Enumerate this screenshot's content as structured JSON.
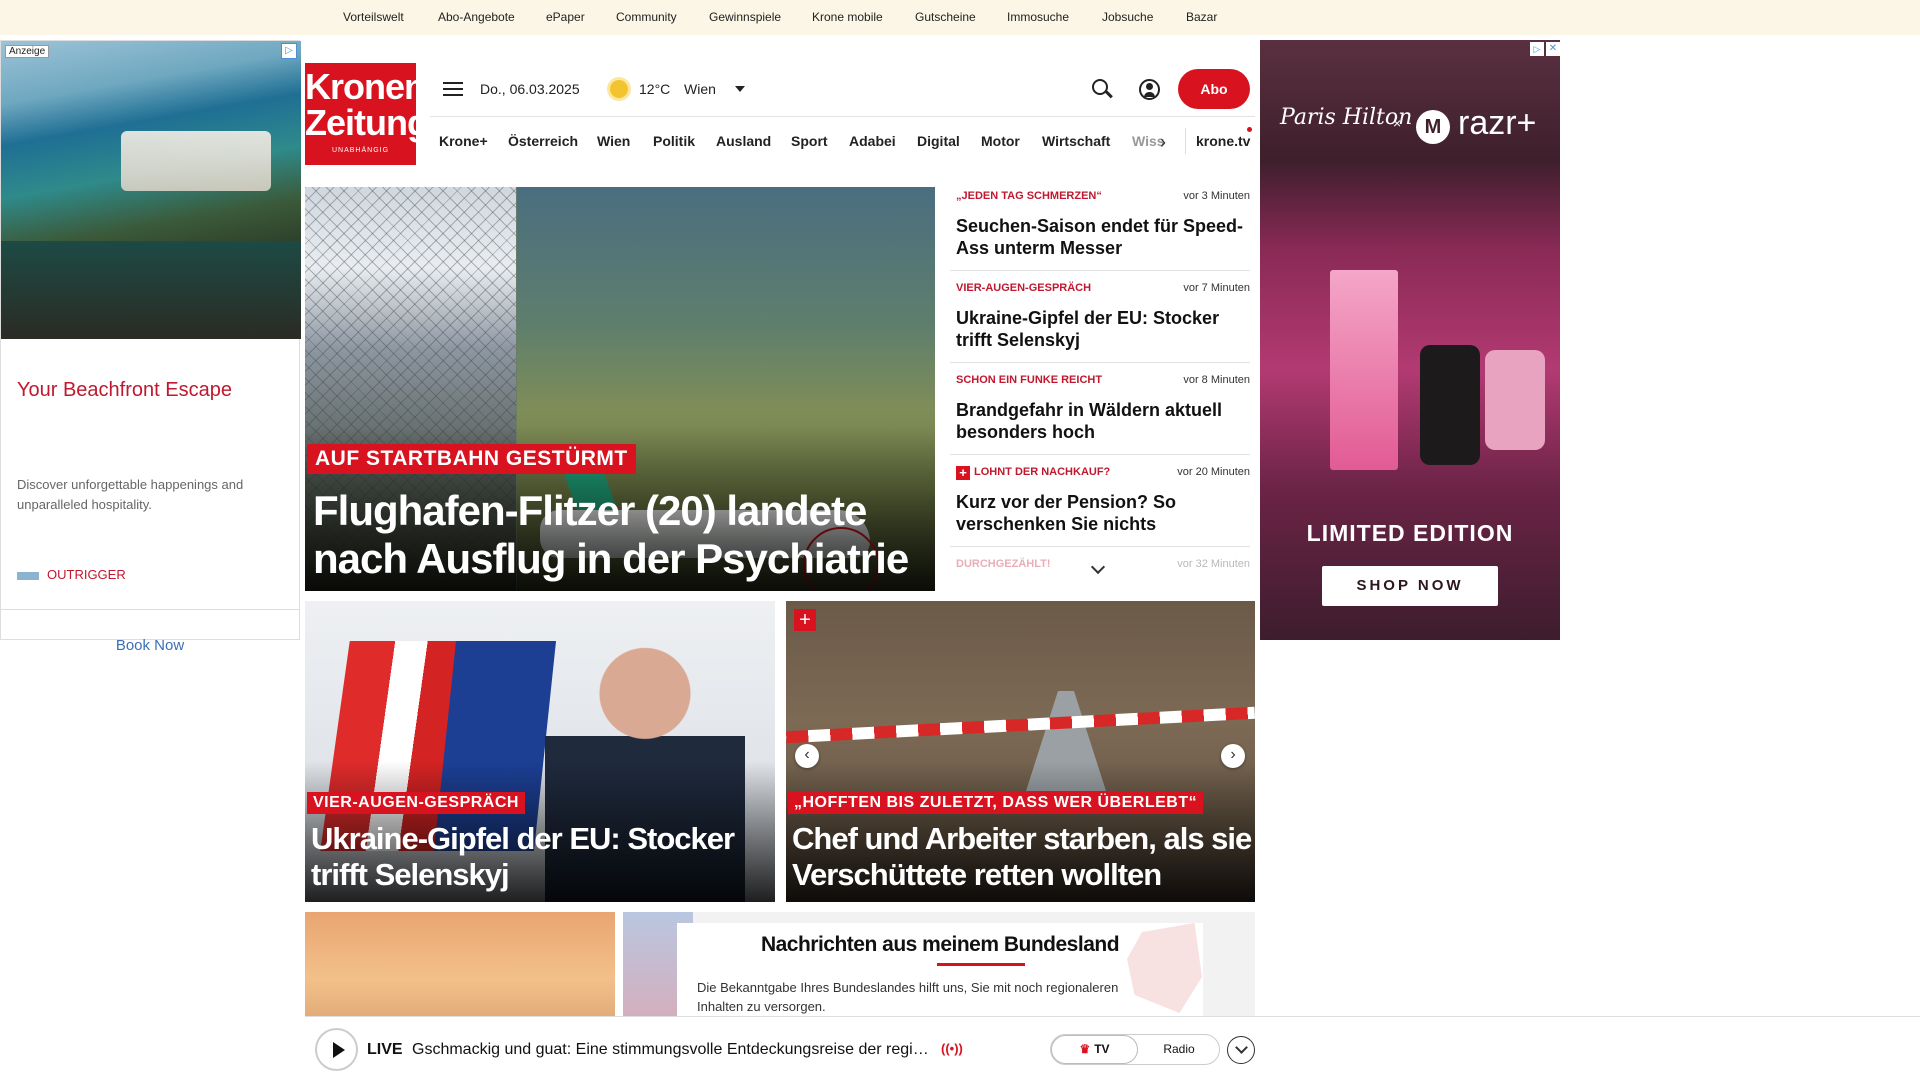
{
  "topbar": {
    "links": [
      "Vorteilswelt",
      "Abo-Angebote",
      "ePaper",
      "Community",
      "Gewinnspiele",
      "Krone mobile",
      "Gutscheine",
      "Immosuche",
      "Jobsuche",
      "Bazar"
    ]
  },
  "ad_left": {
    "tag": "Anzeige",
    "headline": "Your Beachfront Escape",
    "text": "Discover unforgettable happenings and unparalleled hospitality.",
    "brand": "OUTRIGGER",
    "cta": "Book Now"
  },
  "ad_right": {
    "paris_hilton": "Paris Hilton",
    "x": "×",
    "razr": "razr+",
    "limited": "LIMITED EDITION",
    "cta": "SHOP NOW"
  },
  "header": {
    "logo_line1": "Kronen",
    "logo_line2": "Zeitung",
    "logo_line3": "UNABHÄNGIG",
    "date": "Do., 06.03.2025",
    "temperature": "12°C",
    "city": "Wien",
    "abo_label": "Abo"
  },
  "nav": {
    "items": [
      "Krone+",
      "Österreich",
      "Wien",
      "Politik",
      "Ausland",
      "Sport",
      "Adabei",
      "Digital",
      "Motor",
      "Wirtschaft",
      "Wiss"
    ],
    "krone_tv": "krone.tv"
  },
  "hero": {
    "kicker": "AUF STARTBAHN GESTÜRMT",
    "headline": "Flughafen-Flitzer (20) landete nach Ausflug in der Psychiatrie"
  },
  "ticker": [
    {
      "kicker": "„JEDEN TAG SCHMERZEN“",
      "time": "vor 3 Minuten",
      "headline": "Seuchen-Saison endet für Speed-Ass unterm Messer",
      "plus": false
    },
    {
      "kicker": "VIER-AUGEN-GESPRÄCH",
      "time": "vor 7 Minuten",
      "headline": "Ukraine-Gipfel der EU: Stocker trifft Selenskyj",
      "plus": false
    },
    {
      "kicker": "SCHON EIN FUNKE REICHT",
      "time": "vor 8 Minuten",
      "headline": "Brandgefahr in Wäldern aktuell besonders hoch",
      "plus": false
    },
    {
      "kicker": "LOHNT DER NACHKAUF?",
      "time": "vor 20 Minuten",
      "headline": "Kurz vor der Pension? So verschenken Sie nichts",
      "plus": true
    },
    {
      "kicker": "DURCHGEZÄHLT!",
      "time": "vor 32 Minuten",
      "headline": "",
      "plus": false
    }
  ],
  "cards": [
    {
      "kicker": "VIER-AUGEN-GESPRÄCH",
      "headline": "Ukraine-Gipfel der EU: Stocker trifft Selenskyj"
    },
    {
      "kicker": "„HOFFTEN BIS ZULETZT, DASS WER ÜBERLEBT“",
      "headline": "Chef und Arbeiter starben, als sie Verschüttete retten wollten"
    }
  ],
  "bundesland": {
    "title": "Nachrichten aus meinem Bundesland",
    "text": "Die Bekanntgabe Ihres Bundeslandes hilft uns, Sie mit noch regionaleren Inhalten zu versorgen."
  },
  "player": {
    "live": "LIVE",
    "title": "Gschmackig und guat: Eine stimmungsvolle Entdeckungsreise der regio...",
    "wave": "((•))",
    "tv": "TV",
    "radio": "Radio"
  },
  "colors": {
    "brand_red": "#d8121f",
    "topbar_bg": "#fbf6e6"
  }
}
